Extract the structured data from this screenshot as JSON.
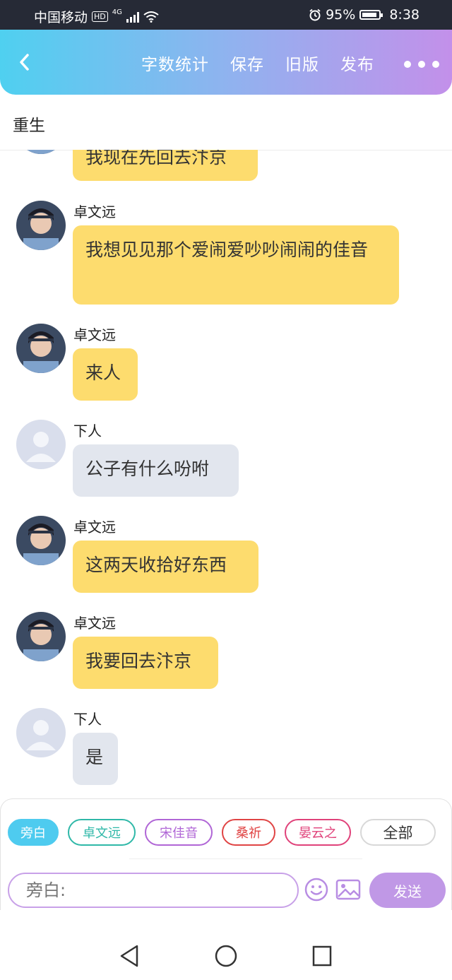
{
  "status_bar": {
    "carrier": "中国移动",
    "hd_badge": "HD",
    "network": "4G",
    "battery_percent": "95%",
    "time": "8:38",
    "icons": [
      "signal-icon",
      "wifi-icon",
      "alarm-icon",
      "battery-icon"
    ]
  },
  "header": {
    "actions": [
      "字数统计",
      "保存",
      "旧版",
      "发布"
    ],
    "icons": [
      "back-arrow-icon",
      "more-dots-icon"
    ],
    "gradient": [
      "#4fd0f0",
      "#c390ea"
    ]
  },
  "chapter": {
    "title": "重生"
  },
  "messages": [
    {
      "speaker": "",
      "text": "我现在先回去汴京",
      "style": "yellow"
    },
    {
      "speaker": "卓文远",
      "text": "我想见见那个爱闹爱吵吵闹闹的佳音",
      "style": "yellow"
    },
    {
      "speaker": "卓文远",
      "text": "来人",
      "style": "yellow"
    },
    {
      "speaker": "下人",
      "text": "公子有什么吩咐",
      "style": "gray"
    },
    {
      "speaker": "卓文远",
      "text": "这两天收拾好东西",
      "style": "yellow"
    },
    {
      "speaker": "卓文远",
      "text": "我要回去汴京",
      "style": "yellow"
    },
    {
      "speaker": "下人",
      "text": "是",
      "style": "gray"
    }
  ],
  "characters": [
    {
      "label": "旁白",
      "color": "#4ecbef",
      "selected": true
    },
    {
      "label": "卓文远",
      "color": "#2fb8a8",
      "selected": false
    },
    {
      "label": "宋佳音",
      "color": "#b066d6",
      "selected": false
    },
    {
      "label": "桑祈",
      "color": "#e04444",
      "selected": false
    },
    {
      "label": "晏云之",
      "color": "#e0427a",
      "selected": false
    },
    {
      "label": "全部",
      "color": "#cccccc",
      "selected": false
    }
  ],
  "composer": {
    "placeholder": "旁白:",
    "send_label": "发送",
    "icons": [
      "emoji-icon",
      "image-icon"
    ]
  },
  "nav_bar": {
    "icons": [
      "back-triangle-icon",
      "home-circle-icon",
      "recents-square-icon"
    ]
  },
  "colors": {
    "bubble_yellow": "#fddc6e",
    "bubble_gray": "#e2e6ee",
    "accent_purple": "#c098e6"
  }
}
